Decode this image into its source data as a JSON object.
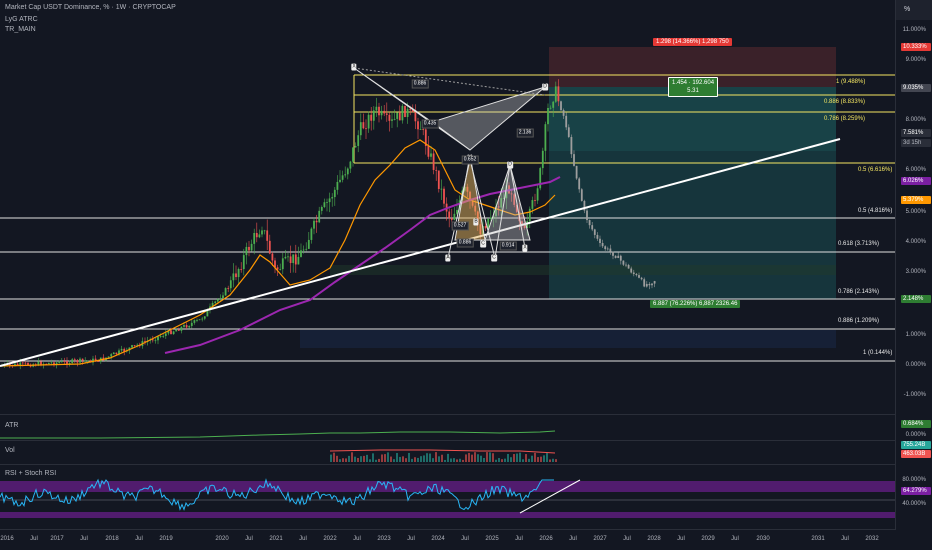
{
  "legend": {
    "title": "Market Cap USDT Dominance, % · 1W · CRYPTOCAP",
    "indicator1": "LyG ATRC",
    "indicator2": "TR_MAIN"
  },
  "scale_button": "%",
  "price_axis": {
    "ticks": [
      "11.000%",
      "9.000%",
      "8.000%",
      "6.000%",
      "5.000%",
      "4.000%",
      "3.000%",
      "1.000%",
      "0.000%",
      "-1.000%"
    ],
    "badges": {
      "red_top": "10.333%",
      "current": "9.035%",
      "last": "7.581%",
      "countdown": "3d 15h",
      "ema": "6.026%",
      "orange": "5.379%",
      "target": "2.148%"
    },
    "sub_ticks": [
      "0.684%",
      "0.000%",
      "755.24B",
      "463.03B",
      "80.000%",
      "64.279%",
      "40.000%"
    ]
  },
  "fib_levels": [
    {
      "label": "1 (9.488%)",
      "color": "yellow"
    },
    {
      "label": "0.886 (8.833%)",
      "color": "yellow"
    },
    {
      "label": "0.786 (8.259%)",
      "color": "yellow"
    },
    {
      "label": "0.5 (6.616%)",
      "color": "yellow"
    },
    {
      "label": "0.5 (4.816%)",
      "color": "white"
    },
    {
      "label": "0.618 (3.713%)",
      "color": "white"
    },
    {
      "label": "0.786 (2.143%)",
      "color": "white"
    },
    {
      "label": "0.886 (1.209%)",
      "color": "white"
    },
    {
      "label": "1 (0.144%)",
      "color": "white"
    }
  ],
  "position_tool": {
    "stop_label": "1.298 (14.366%) 1,298 750",
    "ratio_label_line1": "1.454 · 192.604",
    "ratio_label_line2": "5.31",
    "target_label": "6.887 (76.226%) 6,887 2326.46"
  },
  "pattern_points": {
    "x": "X",
    "a": "A",
    "b": "B",
    "c": "C",
    "d": "D",
    "c1": "C",
    "d1": "D",
    "x2": "X",
    "b2": "B"
  },
  "pattern_ratios": {
    "r1": "0.886",
    "r2": "0.435",
    "r3": "2.136",
    "r4": "0.527",
    "r5": "0.886",
    "r6": "0.914",
    "r7": "0.652"
  },
  "panes": {
    "atr": "ATR",
    "vol": "Vol",
    "rsi": "RSI + Stoch RSI"
  },
  "time_axis": [
    "2016",
    "Jul",
    "2017",
    "Jul",
    "2018",
    "Jul",
    "2019",
    "2020",
    "Jul",
    "2021",
    "Jul",
    "2022",
    "Jul",
    "2023",
    "Jul",
    "2024",
    "Jul",
    "2025",
    "Jul",
    "2026",
    "Jul",
    "2027",
    "Jul",
    "2028",
    "Jul",
    "2029",
    "Jul",
    "2030",
    "2031",
    "Jul",
    "2032"
  ],
  "colors": {
    "background": "#131722",
    "fib_yellow": "#f5e663",
    "up_green": "#4caf50",
    "down_red": "#ef5350",
    "ema_purple": "#9c27b0",
    "ema_orange": "#ff9800",
    "atr_green": "#4caf50",
    "rsi_blue": "#29b6f6"
  }
}
